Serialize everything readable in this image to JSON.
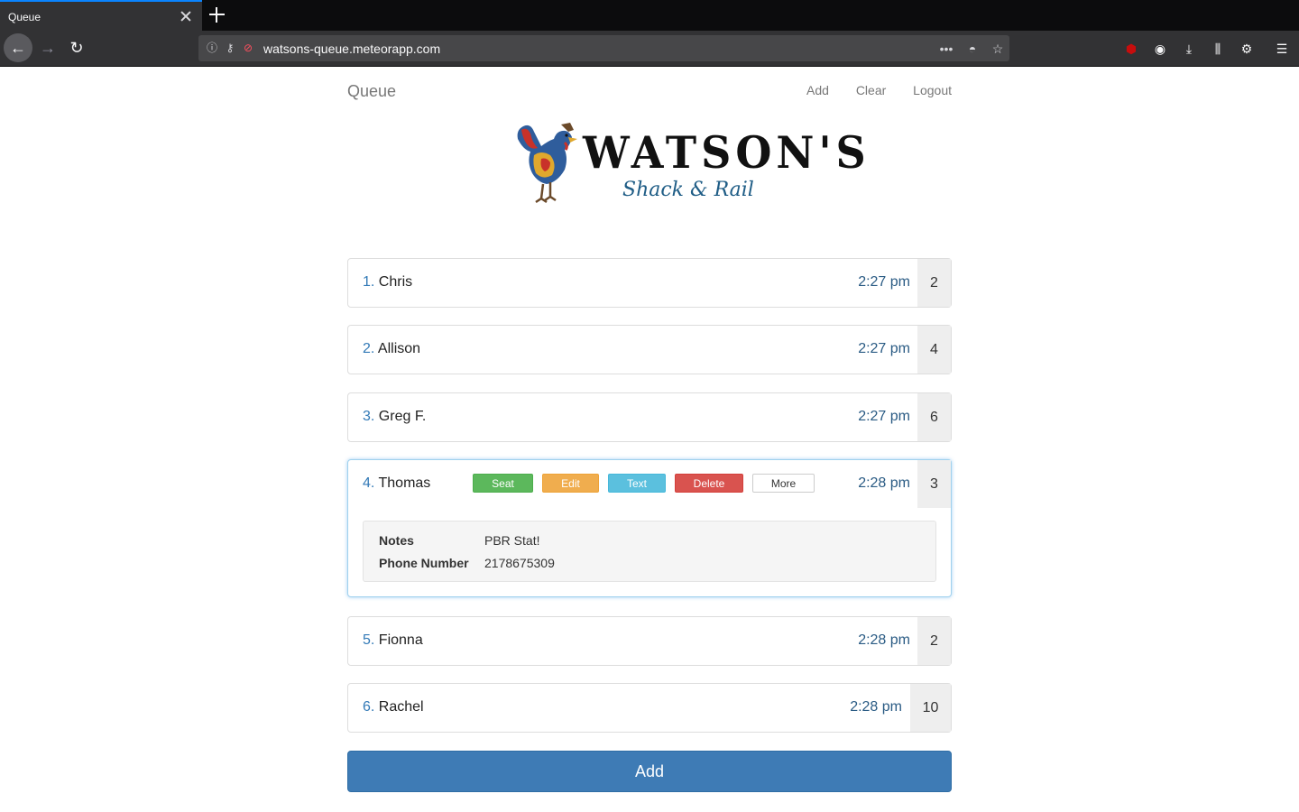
{
  "browser": {
    "tab_title": "Queue",
    "url": "watsons-queue.meteorapp.com"
  },
  "nav": {
    "brand": "Queue",
    "links": [
      "Add",
      "Clear",
      "Logout"
    ]
  },
  "logo": {
    "wordmark": "WATSON'S",
    "subtitle": "Shack & Rail"
  },
  "queue": [
    {
      "num": "1.",
      "name": "Chris",
      "time": "2:27 pm",
      "party": "2"
    },
    {
      "num": "2.",
      "name": "Allison",
      "time": "2:27 pm",
      "party": "4"
    },
    {
      "num": "3.",
      "name": "Greg F.",
      "time": "2:27 pm",
      "party": "6"
    },
    {
      "num": "4.",
      "name": "Thomas",
      "time": "2:28 pm",
      "party": "3"
    },
    {
      "num": "5.",
      "name": "Fionna",
      "time": "2:28 pm",
      "party": "2"
    },
    {
      "num": "6.",
      "name": "Rachel",
      "time": "2:28 pm",
      "party": "10"
    }
  ],
  "actions": {
    "seat": "Seat",
    "edit": "Edit",
    "text": "Text",
    "delete": "Delete",
    "more": "More"
  },
  "details": {
    "notes_label": "Notes",
    "notes_value": "PBR Stat!",
    "phone_label": "Phone Number",
    "phone_value": "2178675309"
  },
  "add_button": "Add",
  "colors": {
    "primary": "#3e7bb5",
    "seat": "#5cb85c",
    "edit": "#f0ad4e",
    "text": "#5bc0de",
    "delete": "#d9534f",
    "time": "#2a5b84"
  }
}
